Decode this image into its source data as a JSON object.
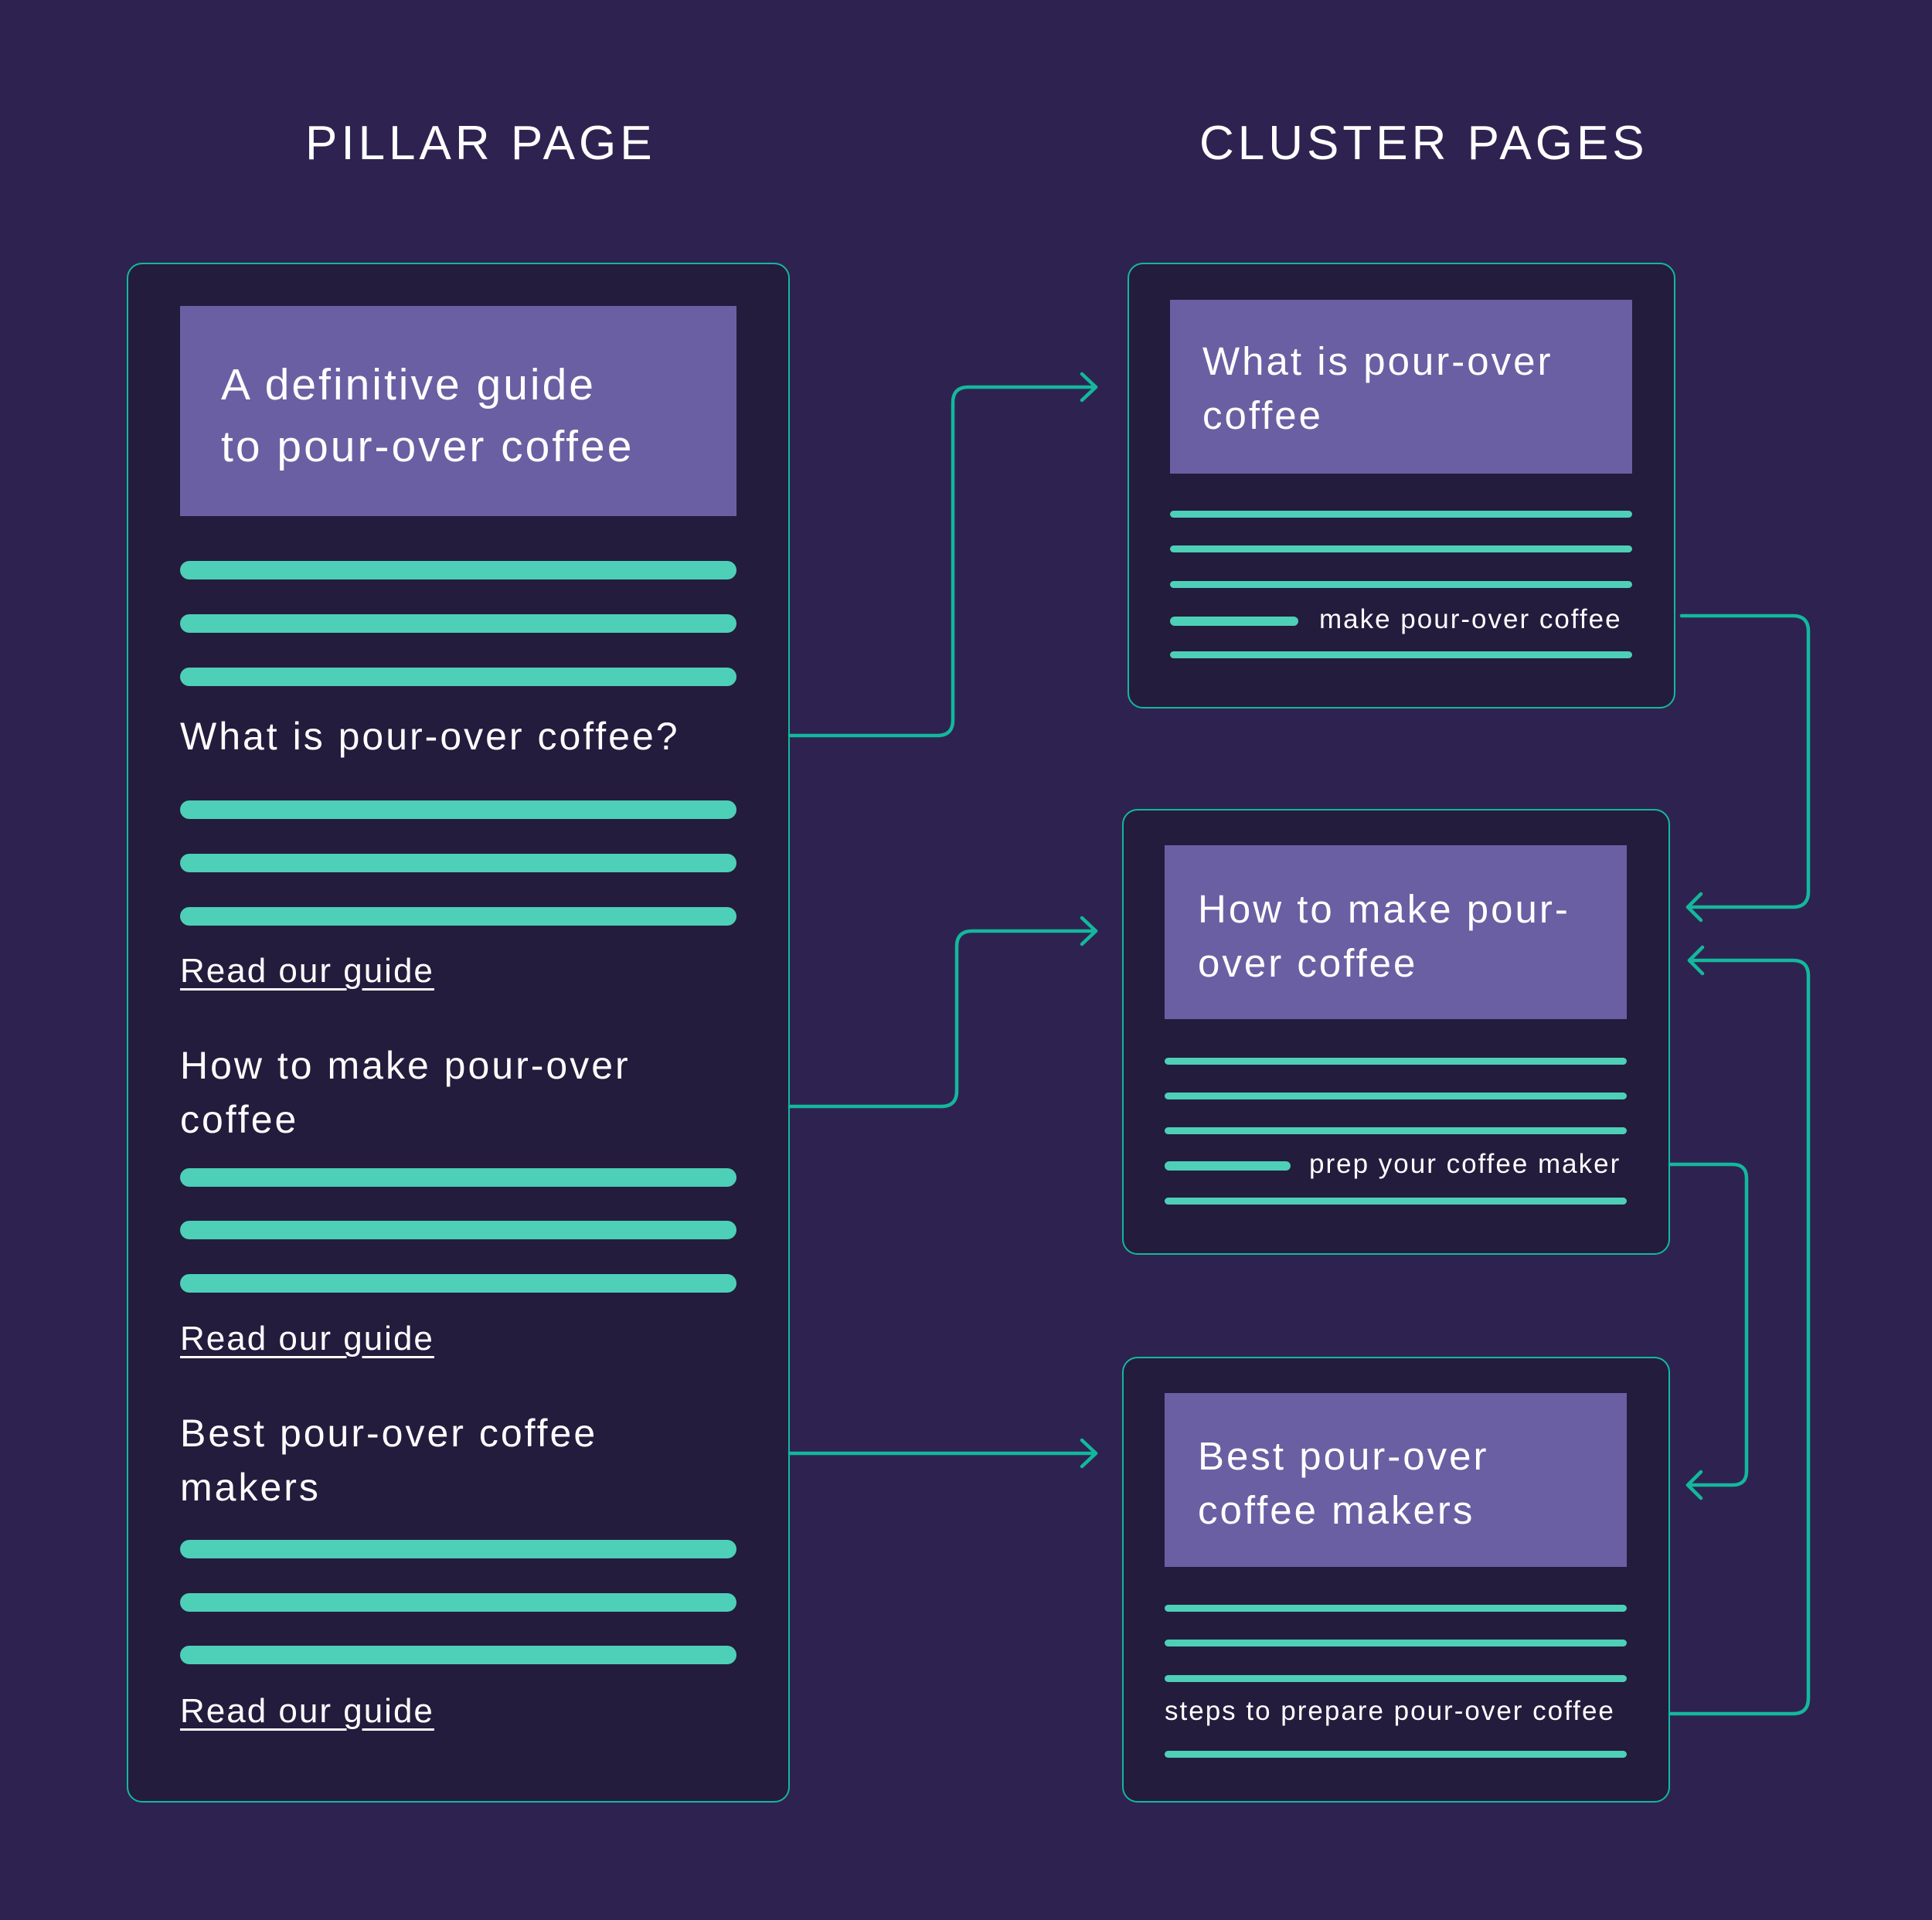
{
  "headers": {
    "pillar": "PILLAR PAGE",
    "cluster": "CLUSTER PAGES"
  },
  "pillar_page": {
    "title_line1": "A definitive guide",
    "title_line2": "to pour-over coffee",
    "sections": [
      {
        "heading_line1": "What is pour-over coffee?",
        "heading_line2": "",
        "link": "Read our guide"
      },
      {
        "heading_line1": "How to make pour-over",
        "heading_line2": "coffee",
        "link": "Read our guide"
      },
      {
        "heading_line1": "Best pour-over coffee",
        "heading_line2": "makers",
        "link": "Read our guide"
      }
    ]
  },
  "cluster_pages": [
    {
      "title_line1": "What is pour-over",
      "title_line2": "coffee",
      "anchor_text": "make pour-over coffee"
    },
    {
      "title_line1": "How to make pour-",
      "title_line2": "over coffee",
      "anchor_text": "prep your coffee maker"
    },
    {
      "title_line1": "Best pour-over",
      "title_line2": "coffee makers",
      "anchor_text": "steps to prepare pour-over coffee"
    }
  ],
  "colors": {
    "background": "#2e2350",
    "card": "#231c3d",
    "accent": "#13b89c",
    "bar": "#4ecfb8",
    "title_box": "#6b5fa3"
  }
}
